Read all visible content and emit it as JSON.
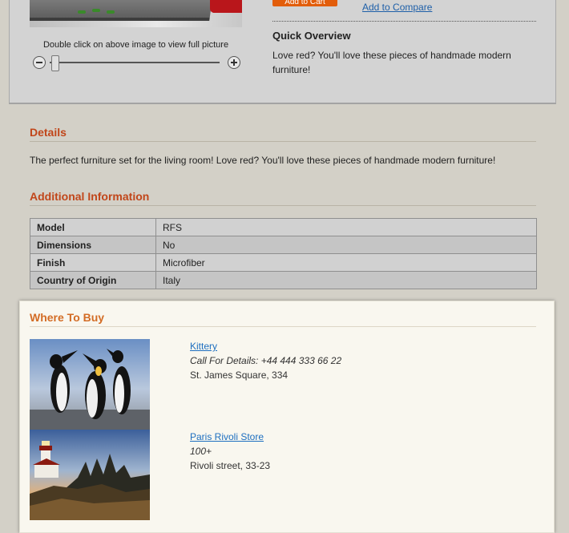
{
  "product": {
    "image_note": "Double click on above image to view  full picture",
    "add_to_cart_label": "Add to Cart",
    "add_to_compare_label": "Add to Compare"
  },
  "quick_overview": {
    "title": "Quick Overview",
    "text": "Love red? You'll love these pieces of handmade modern furniture!"
  },
  "details": {
    "title": "Details",
    "text": "The perfect furniture set for the living room! Love red? You'll love these pieces of handmade modern furniture!"
  },
  "additional_info": {
    "title": "Additional Information",
    "rows": [
      {
        "label": "Model",
        "value": "RFS"
      },
      {
        "label": "Dimensions",
        "value": "No"
      },
      {
        "label": "Finish",
        "value": "Microfiber"
      },
      {
        "label": "Country of Origin",
        "value": "Italy"
      }
    ]
  },
  "where_to_buy": {
    "title": "Where To Buy",
    "stores": [
      {
        "name": "Kittery",
        "phone": "Call For Details: +44 444 333 66 22",
        "address": "St. James Square, 334",
        "image_icon": "penguins-photo"
      },
      {
        "name": "Paris Rivoli Store",
        "phone": "100+",
        "address": "Rivoli street, 33-23",
        "image_icon": "lighthouse-photo"
      }
    ]
  },
  "colors": {
    "section_title": "#c1461a",
    "where_to_buy_title": "#d36c25",
    "link": "#1e6fc0",
    "add_to_cart": "#e25d0a"
  }
}
